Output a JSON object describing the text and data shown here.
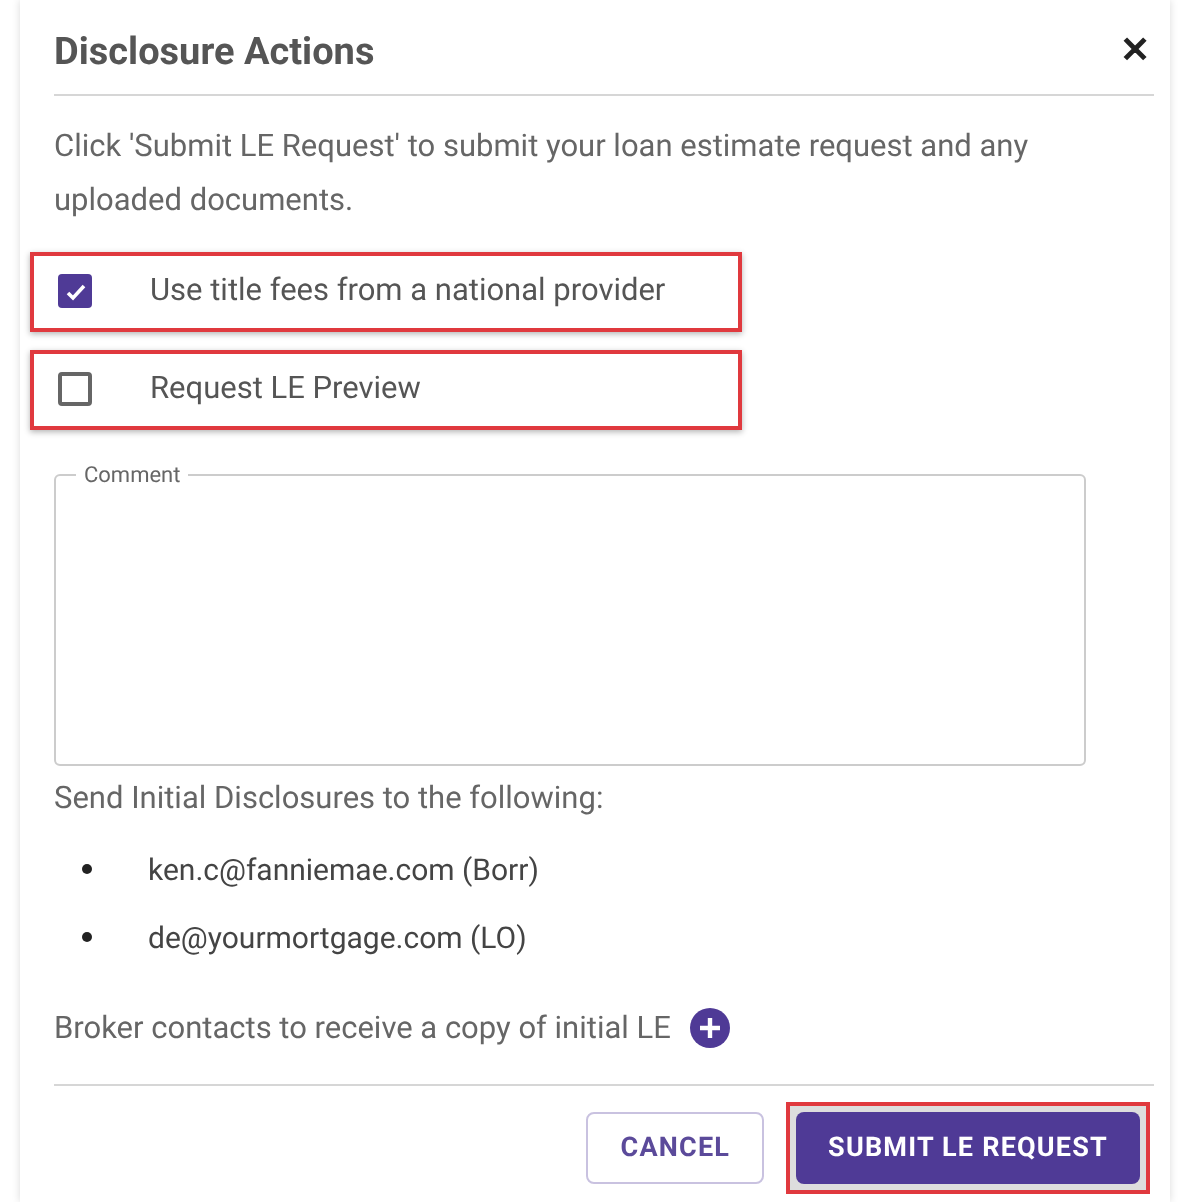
{
  "dialog": {
    "title": "Disclosure Actions",
    "close": "✕"
  },
  "instructions": "Click 'Submit LE Request' to submit your loan estimate request and any uploaded documents.",
  "options": [
    {
      "label": "Use title fees from a national provider",
      "checked": true,
      "highlighted": true
    },
    {
      "label": "Request LE Preview",
      "checked": false,
      "highlighted": true
    }
  ],
  "comment": {
    "label": "Comment"
  },
  "recipients": {
    "heading": "Send Initial Disclosures to the following:",
    "items": [
      "ken.c@fanniemae.com (Borr)",
      "de@yourmortgage.com (LO)"
    ]
  },
  "broker": {
    "label": "Broker contacts to receive a copy of initial LE"
  },
  "buttons": [
    {
      "kind": "outline",
      "label": "CANCEL",
      "highlighted": false
    },
    {
      "kind": "primary",
      "label": "SUBMIT LE REQUEST",
      "highlighted": true
    }
  ]
}
